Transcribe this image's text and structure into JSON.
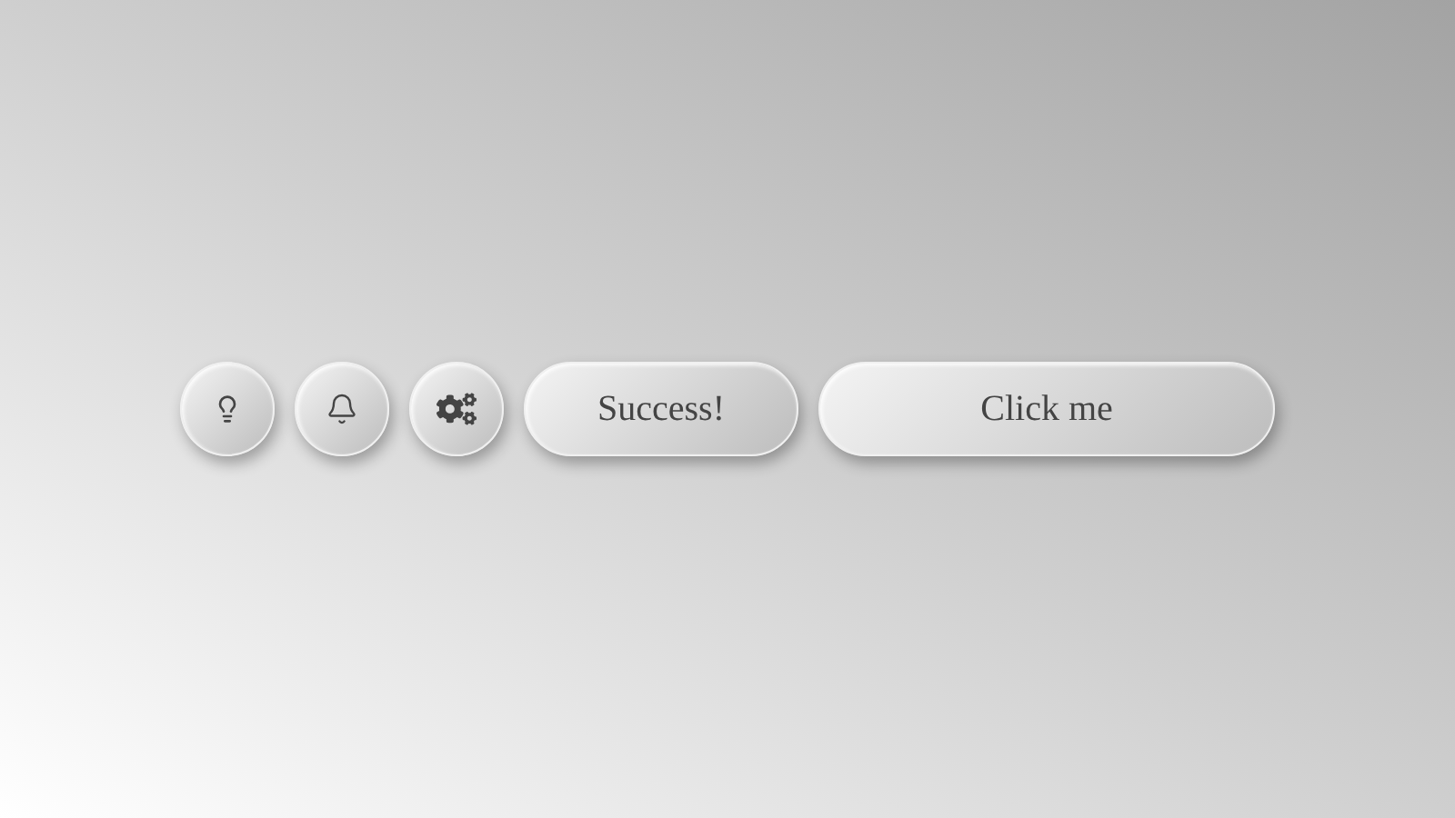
{
  "buttons": [
    {
      "kind": "icon"
    },
    {
      "kind": "icon"
    },
    {
      "kind": "icon"
    },
    {
      "kind": "text",
      "label": "Success!"
    },
    {
      "kind": "text",
      "label": "Click me"
    }
  ]
}
